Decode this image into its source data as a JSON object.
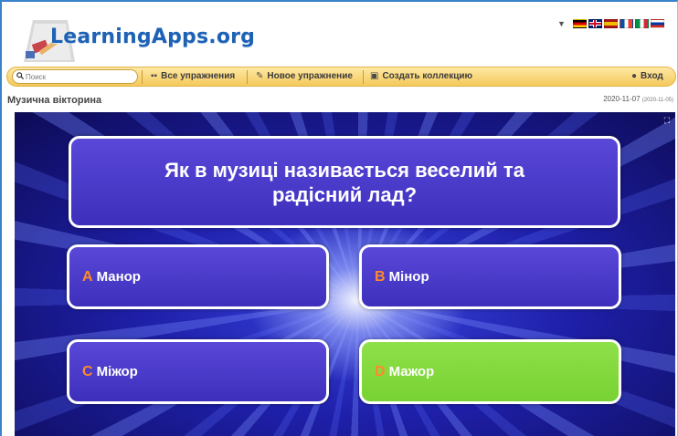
{
  "header": {
    "logo_text": "LearningApps.org",
    "language_dropdown_icon": "triangle-down-icon",
    "flags": [
      {
        "name": "flag-de",
        "colors": [
          "#000000",
          "#dd0000",
          "#ffce00"
        ]
      },
      {
        "name": "flag-gb",
        "colors": [
          "#012169",
          "#ffffff",
          "#c8102e"
        ]
      },
      {
        "name": "flag-es",
        "colors": [
          "#aa151b",
          "#f1bf00",
          "#aa151b"
        ]
      },
      {
        "name": "flag-fr",
        "colors": [
          "#0055a4",
          "#ffffff",
          "#ef4135"
        ]
      },
      {
        "name": "flag-it",
        "colors": [
          "#009246",
          "#ffffff",
          "#ce2b37"
        ]
      },
      {
        "name": "flag-ru",
        "colors": [
          "#ffffff",
          "#0039a6",
          "#d52b1e"
        ]
      }
    ]
  },
  "toolbar": {
    "search_placeholder": "Поиск",
    "all_exercises_label": "Все упражнения",
    "new_exercise_label": "Новое упражнение",
    "create_collection_label": "Создать коллекцию",
    "login_label": "Вход"
  },
  "page": {
    "title": "Музична вікторина",
    "date": "2020-11-07",
    "date_small": "(2020-11-05)"
  },
  "quiz": {
    "question": "Як в музиці називається веселий та радісний лад?",
    "answers": [
      {
        "letter": "A",
        "text": "Манор"
      },
      {
        "letter": "B",
        "text": "Мінор"
      },
      {
        "letter": "C",
        "text": "Міжор"
      },
      {
        "letter": "D",
        "text": "Мажор"
      }
    ],
    "selected_color": "#86dc40",
    "default_color": "#4a3bcc"
  }
}
